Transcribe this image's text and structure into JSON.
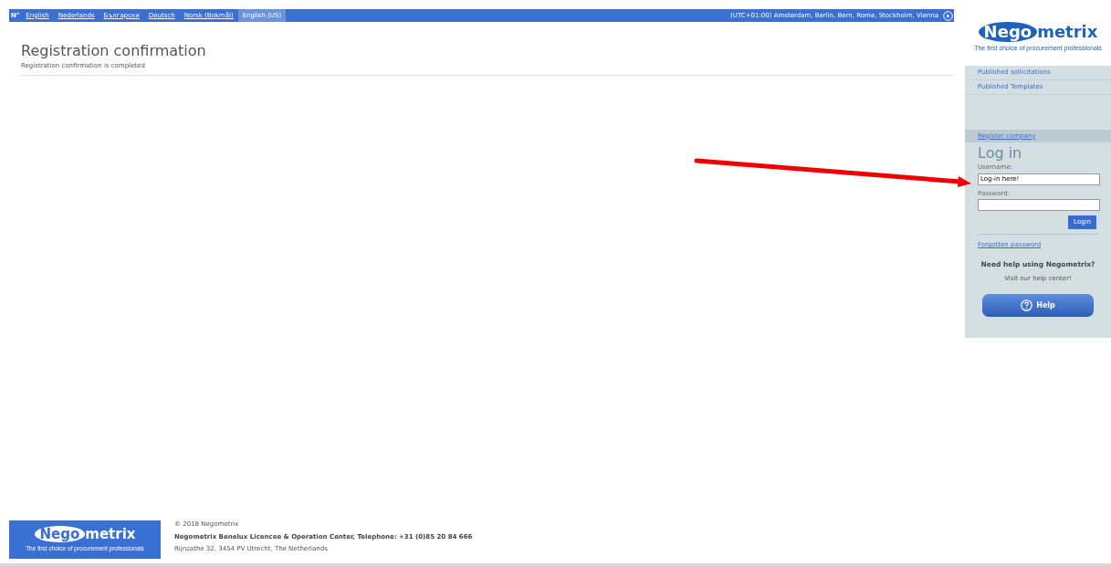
{
  "top_bar": {
    "logo_mark": "N°",
    "languages": [
      {
        "label": "English",
        "selected": false
      },
      {
        "label": "Nederlands",
        "selected": false
      },
      {
        "label": "Български",
        "selected": false
      },
      {
        "label": "Deutsch",
        "selected": false
      },
      {
        "label": "Norsk (Bokmål)",
        "selected": false
      },
      {
        "label": "English (US)",
        "selected": true
      }
    ],
    "timezone": "(UTC+01:00) Amsterdam, Berlin, Bern, Rome, Stockholm, Vienna"
  },
  "main": {
    "title": "Registration confirmation",
    "message": "Registration confirmation is completed"
  },
  "sidebar": {
    "logo": {
      "part_1": "Nego",
      "part_2": "metrix",
      "tagline": "The first choice of procurement professionals"
    },
    "links": [
      "Published sollicitations",
      "Published Templates"
    ],
    "register_link": "Register company",
    "login": {
      "heading": "Log in",
      "username_label": "Username:",
      "username_value": "Log-in here!",
      "password_label": "Password:",
      "button": "Login"
    },
    "forgot_link": "Forgotten password",
    "help_heading": "Need help using Negometrix?",
    "help_text": "Visit our help center!",
    "help_button": "Help"
  },
  "footer": {
    "logo": {
      "part_1": "Nego",
      "part_2": "metrix",
      "tagline": "The first choice of procurement professionals"
    },
    "copyright": "© 2018 Negometrix",
    "company": "Negometrix Benelux Licencee & Operation Center, Telephone: +31 (0)85 20 84 666",
    "address": "Rijnzathe 32, 3454 PV Utrecht, The Netherlands"
  }
}
